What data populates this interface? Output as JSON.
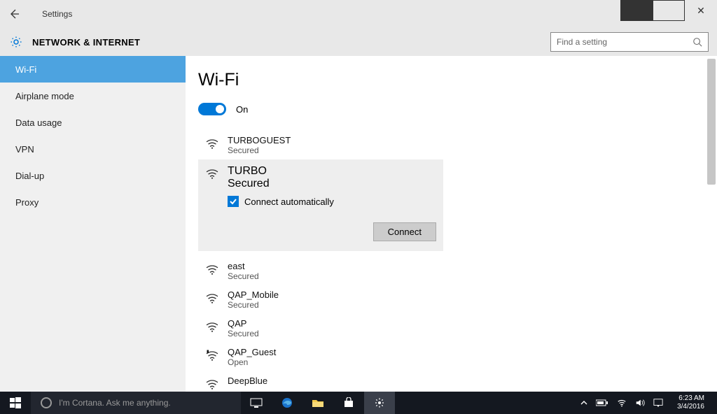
{
  "window": {
    "app_title": "Settings",
    "category": "NETWORK & INTERNET",
    "search_placeholder": "Find a setting"
  },
  "sidebar": {
    "items": [
      {
        "label": "Wi-Fi",
        "selected": true
      },
      {
        "label": "Airplane mode",
        "selected": false
      },
      {
        "label": "Data usage",
        "selected": false
      },
      {
        "label": "VPN",
        "selected": false
      },
      {
        "label": "Dial-up",
        "selected": false
      },
      {
        "label": "Proxy",
        "selected": false
      }
    ]
  },
  "content": {
    "heading": "Wi-Fi",
    "toggle_state": "On",
    "networks": [
      {
        "name": "TURBOGUEST",
        "security": "Secured",
        "icon": "wifi-secured-icon",
        "expanded": false
      },
      {
        "name": "TURBO",
        "security": "Secured",
        "icon": "wifi-secured-icon",
        "expanded": true,
        "auto_label": "Connect automatically",
        "auto_checked": true,
        "connect_label": "Connect"
      },
      {
        "name": "east",
        "security": "Secured",
        "icon": "wifi-secured-icon",
        "expanded": false
      },
      {
        "name": "QAP_Mobile",
        "security": "Secured",
        "icon": "wifi-secured-icon",
        "expanded": false
      },
      {
        "name": "QAP",
        "security": "Secured",
        "icon": "wifi-secured-icon",
        "expanded": false
      },
      {
        "name": "QAP_Guest",
        "security": "Open",
        "icon": "wifi-open-warning-icon",
        "expanded": false
      },
      {
        "name": "DeepBlue",
        "security": "",
        "icon": "wifi-secured-icon",
        "expanded": false
      }
    ]
  },
  "taskbar": {
    "cortana_placeholder": "I'm Cortana. Ask me anything.",
    "time": "6:23 AM",
    "date": "3/4/2016"
  }
}
